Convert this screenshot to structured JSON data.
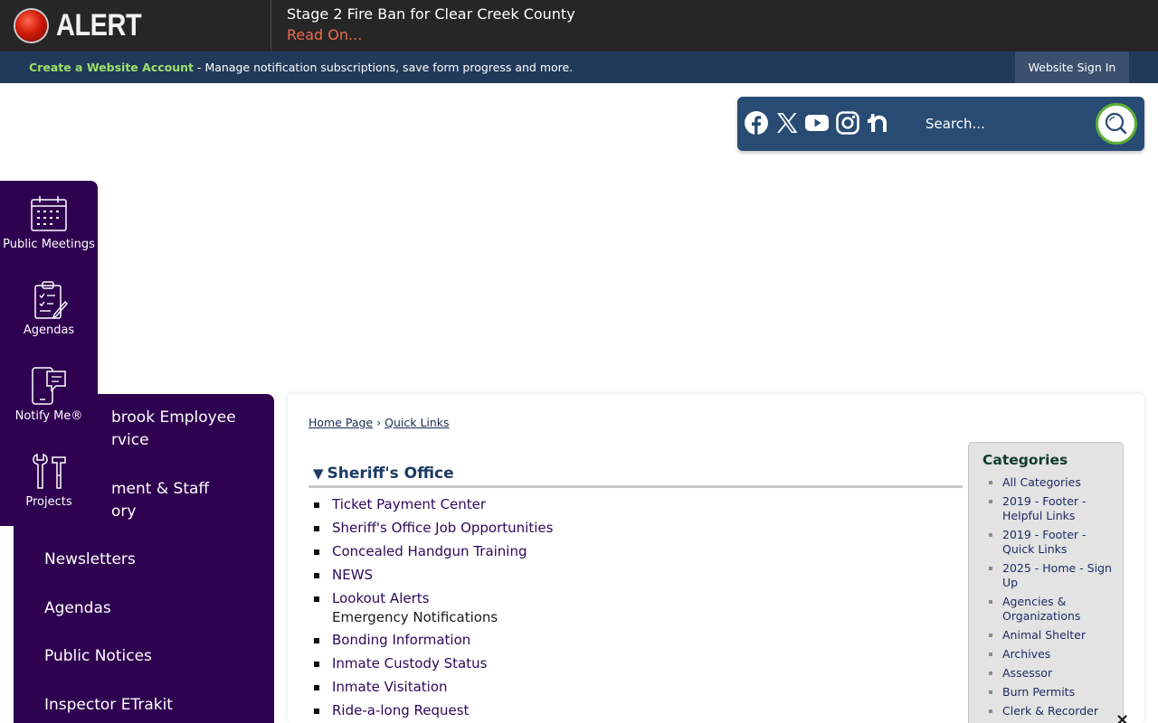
{
  "alert": {
    "label": "ALERT",
    "title": "Stage 2 Fire Ban for Clear Creek County",
    "read_on": "Read On..."
  },
  "account_bar": {
    "create_link": "Create a Website Account",
    "description": " - Manage notification subscriptions, save form progress and more.",
    "sign_in": "Website Sign In"
  },
  "social": {
    "icons": [
      "facebook-icon",
      "x-icon",
      "youtube-icon",
      "instagram-icon",
      "nextdoor-icon"
    ],
    "search_placeholder": "Search..."
  },
  "quick_tray": {
    "items": [
      {
        "label": "Public Meetings",
        "icon": "calendar-icon"
      },
      {
        "label": "Agendas",
        "icon": "clipboard-icon"
      },
      {
        "label": "Notify Me®",
        "icon": "phone-icon"
      },
      {
        "label": "Projects",
        "icon": "tools-icon"
      }
    ]
  },
  "left_menu": {
    "items": [
      {
        "line1": "brook Employee",
        "line2": "rvice"
      },
      {
        "line1": "ment & Staff",
        "line2": "ory"
      },
      {
        "line1": "Newsletters"
      },
      {
        "line1": "Agendas"
      },
      {
        "line1": "Public Notices"
      },
      {
        "line1": "Inspector ETrakit"
      }
    ]
  },
  "breadcrumb": {
    "home": "Home Page",
    "separator": "›",
    "current": "Quick Links"
  },
  "section": {
    "title": "Sheriff's Office",
    "links": [
      {
        "label": "Ticket Payment Center"
      },
      {
        "label": "Sheriff's Office Job Opportunities"
      },
      {
        "label": "Concealed Handgun Training"
      },
      {
        "label": "NEWS"
      },
      {
        "label": "Lookout Alerts",
        "sub": "Emergency Notifications"
      },
      {
        "label": "Bonding Information"
      },
      {
        "label": "Inmate Custody Status"
      },
      {
        "label": "Inmate Visitation"
      },
      {
        "label": "Ride-a-long Request"
      }
    ]
  },
  "categories": {
    "title": "Categories",
    "items": [
      "All Categories",
      "2019 - Footer - Helpful Links",
      "2019 - Footer - Quick Links",
      "2025 - Home - Sign Up",
      "Agencies & Organizations",
      "Animal Shelter",
      "Archives",
      "Assessor",
      "Burn Permits",
      "Clerk & Recorder"
    ]
  },
  "colors": {
    "alert_bar": "#262626",
    "account_bar": "#213a5a",
    "social_box": "#284b73",
    "purple": "#2f0050",
    "read_on": "#f06a4e",
    "create_link": "#9ee06a",
    "search_ring": "#5fae3a"
  },
  "close_symbol": "×"
}
